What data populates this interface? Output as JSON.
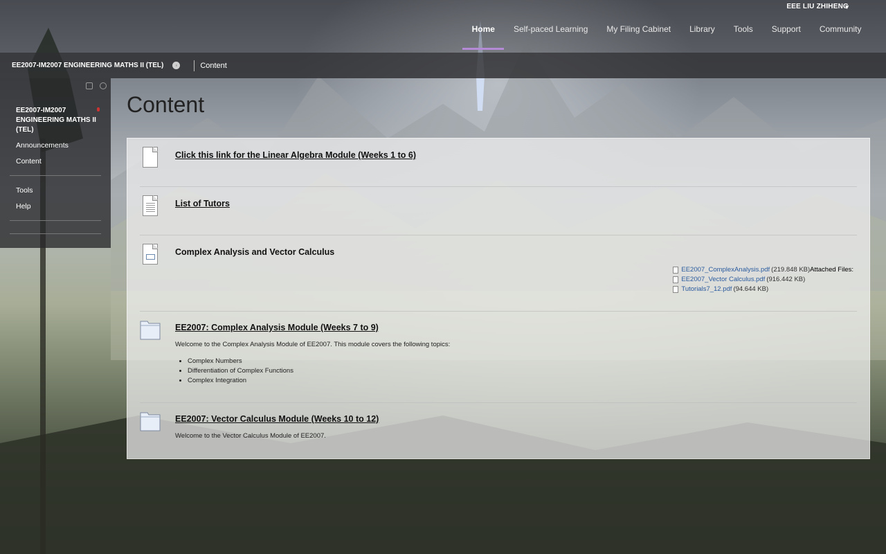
{
  "header": {
    "user_name": "EEE LIU ZHIHENG",
    "nav": [
      {
        "label": "Home",
        "active": true
      },
      {
        "label": "Self-paced Learning"
      },
      {
        "label": "My Filing Cabinet"
      },
      {
        "label": "Library"
      },
      {
        "label": "Tools"
      },
      {
        "label": "Support"
      },
      {
        "label": "Community"
      }
    ],
    "accent_color": "#b48ad6"
  },
  "breadcrumb": {
    "course": "EE2007-IM2007 ENGINEERING MATHS II (TEL)",
    "page": "Content"
  },
  "sidebar": {
    "course_title": "EE2007-IM2007 ENGINEERING MATHS II (TEL)",
    "links": [
      "Announcements",
      "Content",
      "Tools",
      "Help"
    ]
  },
  "main": {
    "page_title": "Content",
    "items": [
      {
        "title": "Click this link for the Linear Algebra Module (Weeks 1 to 6)",
        "type": "link"
      },
      {
        "title": "List of Tutors",
        "type": "document"
      },
      {
        "title": "Complex Analysis and Vector Calculus",
        "type": "file",
        "attached_label": "Attached Files:",
        "files": [
          {
            "name": "EE2007_ComplexAnalysis.pdf",
            "size": "(219.848 KB)"
          },
          {
            "name": "EE2007_Vector Calculus.pdf",
            "size": "(916.442 KB)"
          },
          {
            "name": "Tutorials7_12.pdf",
            "size": "(94.644 KB)"
          }
        ]
      },
      {
        "title": "EE2007: Complex Analysis Module (Weeks 7 to 9)",
        "type": "folder",
        "description": "Welcome to the Complex Analysis Module of EE2007. This module covers the following topics:",
        "topics": [
          "Complex Numbers",
          "Differentiation of Complex Functions",
          "Complex Integration"
        ]
      },
      {
        "title": "EE2007: Vector Calculus Module (Weeks 10 to 12)",
        "type": "folder",
        "description": "Welcome to the Vector Calculus Module of EE2007."
      }
    ]
  },
  "icons": {
    "user_menu": "chevron-down-icon",
    "breadcrumb_options": "circle-options-icon",
    "sidebar_tools": [
      "folder-icon",
      "refresh-icon"
    ]
  }
}
